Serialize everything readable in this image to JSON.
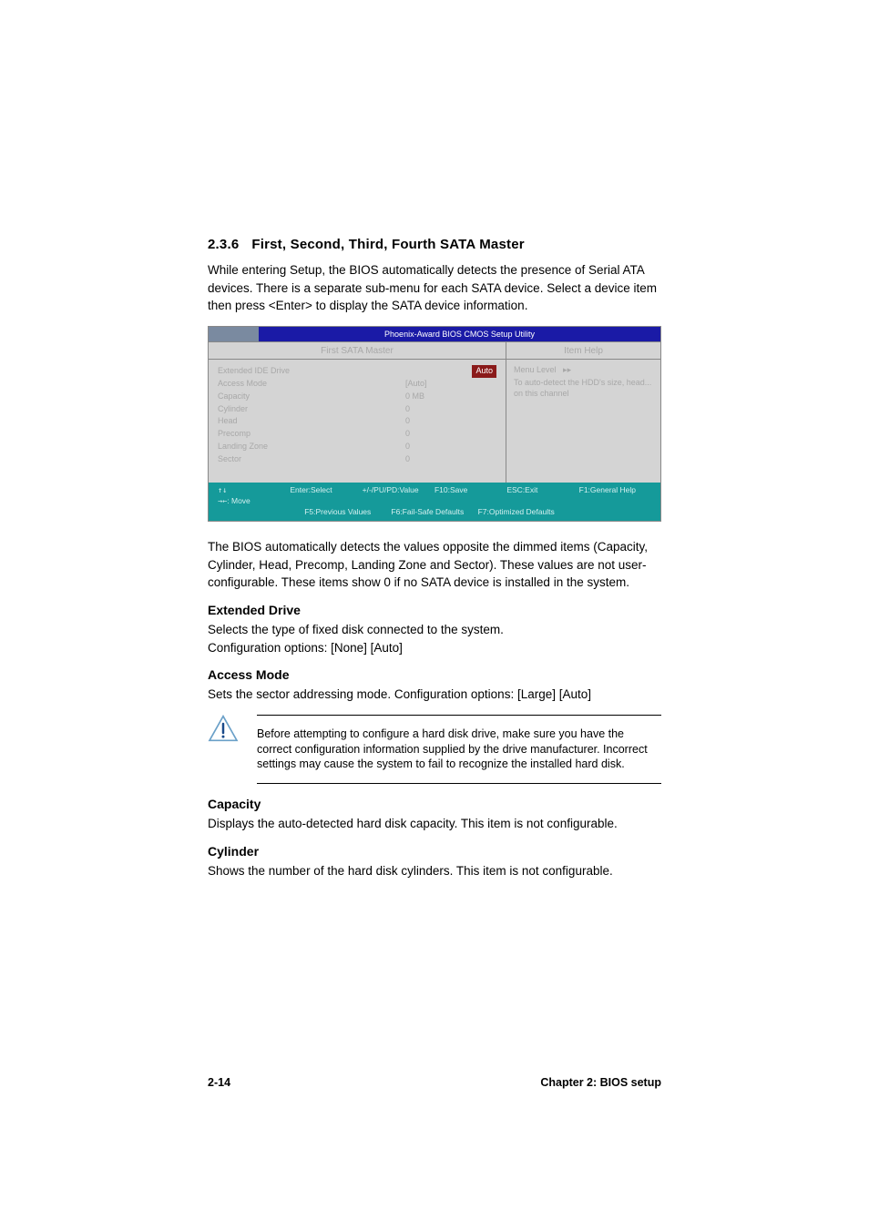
{
  "section": {
    "number": "2.3.6",
    "title": "First, Second, Third, Fourth SATA Master"
  },
  "intro": "While entering Setup, the BIOS automatically detects the presence of Serial ATA devices. There is a separate sub-menu for each SATA device. Select a device item then press <Enter> to display the SATA device information.",
  "bios": {
    "utility_title": "Phoenix-Award BIOS CMOS Setup Utility",
    "panel_title": "First SATA Master",
    "help_title": "Item Help",
    "rows": [
      {
        "label": "Extended IDE Drive",
        "value": "Auto",
        "highlight": true
      },
      {
        "label": "Access Mode",
        "value": "[Auto]"
      },
      {
        "label": "Capacity",
        "value": "0 MB"
      },
      {
        "label": "Cylinder",
        "value": "0"
      },
      {
        "label": "Head",
        "value": "0"
      },
      {
        "label": "Precomp",
        "value": "0"
      },
      {
        "label": "Landing Zone",
        "value": "0"
      },
      {
        "label": "Sector",
        "value": "0"
      }
    ],
    "help": {
      "menu_level": "Menu Level",
      "hint1": "To auto-detect the HDD's size, head... on this channel"
    },
    "footer": {
      "r1c1": "Move",
      "r1c2": "Enter:Select",
      "r1c3": "+/-/PU/PD:Value",
      "r1c4": "F10:Save",
      "r1c5": "ESC:Exit",
      "r1c6": "F1:General Help",
      "r2c1": "F5:Previous Values",
      "r2c2": "F6:Fail-Safe Defaults",
      "r2c3": "F7:Optimized Defaults"
    }
  },
  "after_bios": "The BIOS automatically detects the values opposite the dimmed items (Capacity, Cylinder,  Head, Precomp, Landing Zone and Sector). These values are not user-configurable. These items show 0 if no SATA device is installed in the system.",
  "extended_drive": {
    "heading": "Extended Drive",
    "p1": "Selects the type of fixed disk connected to the system.",
    "p2": "Configuration options: [None] [Auto]"
  },
  "access_mode": {
    "heading": "Access Mode",
    "p1": "Sets the sector addressing mode. Configuration options: [Large] [Auto]"
  },
  "note": "Before attempting to configure a hard disk drive, make sure you have the correct configuration information supplied by the drive manufacturer. Incorrect settings may cause the system to fail to recognize the installed hard disk.",
  "capacity": {
    "heading": "Capacity",
    "p1": "Displays the auto-detected hard disk capacity. This item is not configurable."
  },
  "cylinder": {
    "heading": "Cylinder",
    "p1": "Shows the number of the hard disk cylinders. This item is not configurable."
  },
  "footer": {
    "page": "2-14",
    "chapter": "Chapter 2: BIOS setup"
  }
}
